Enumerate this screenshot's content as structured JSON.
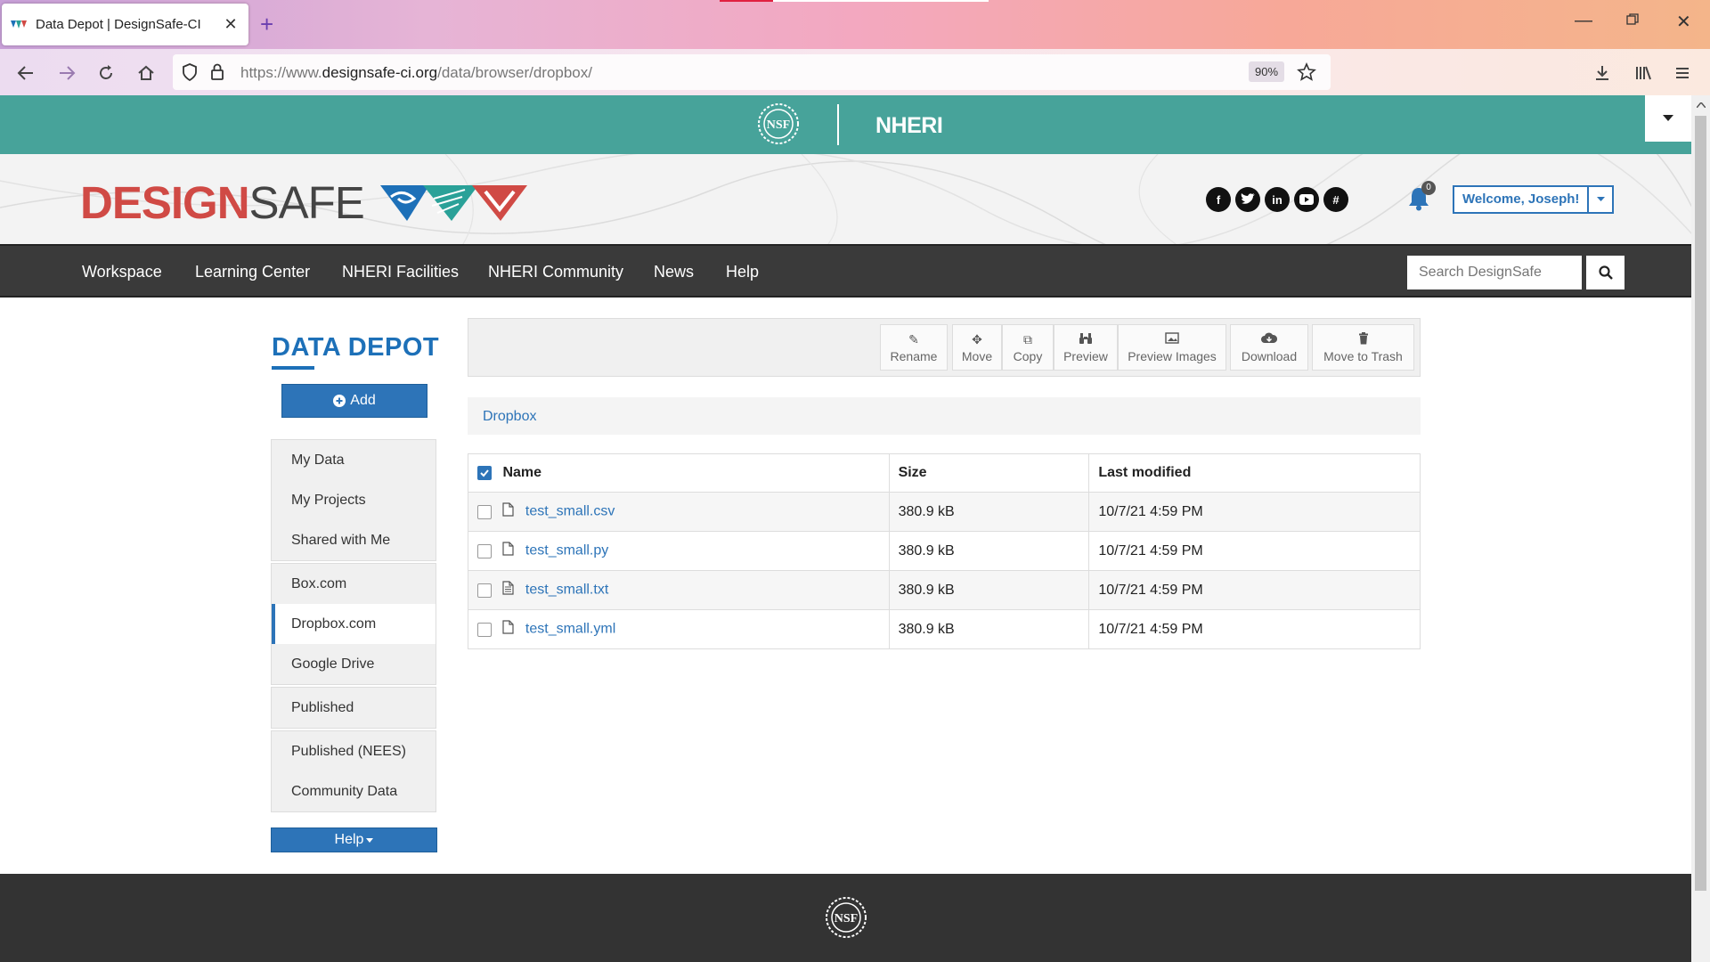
{
  "browser": {
    "tab_title": "Data Depot | DesignSafe-CI",
    "url_prefix": "https://www.",
    "url_domain": "designsafe-ci.org",
    "url_path": "/data/browser/dropbox/",
    "zoom": "90%"
  },
  "header": {
    "nsf_label": "NSF",
    "nheri_label": "NHERI",
    "logo_part1": "DESIGN",
    "logo_part2": "SAFE",
    "notification_count": "0",
    "welcome_label": "Welcome, Joseph!"
  },
  "mainnav": {
    "items": [
      "Workspace",
      "Learning Center",
      "NHERI Facilities",
      "NHERI Community",
      "News",
      "Help"
    ],
    "search_placeholder": "Search DesignSafe"
  },
  "sidebar": {
    "title": "DATA DEPOT",
    "add_label": "Add",
    "items": [
      "My Data",
      "My Projects",
      "Shared with Me",
      "Box.com",
      "Dropbox.com",
      "Google Drive",
      "Published",
      "Published (NEES)",
      "Community Data"
    ],
    "active_item": "Dropbox.com",
    "help_label": "Help"
  },
  "toolbar": {
    "buttons": [
      "Rename",
      "Move",
      "Copy",
      "Preview",
      "Preview Images",
      "Download",
      "Move to Trash"
    ]
  },
  "breadcrumb": "Dropbox",
  "table": {
    "headers": [
      "Name",
      "Size",
      "Last modified"
    ],
    "rows": [
      {
        "name": "test_small.csv",
        "size": "380.9 kB",
        "modified": "10/7/21 4:59 PM"
      },
      {
        "name": "test_small.py",
        "size": "380.9 kB",
        "modified": "10/7/21 4:59 PM"
      },
      {
        "name": "test_small.txt",
        "size": "380.9 kB",
        "modified": "10/7/21 4:59 PM"
      },
      {
        "name": "test_small.yml",
        "size": "380.9 kB",
        "modified": "10/7/21 4:59 PM"
      }
    ]
  },
  "colors": {
    "accent": "#2d74b8",
    "nheri_bar": "#47a39a",
    "logo_red": "#d04a45",
    "nav_dark": "#3a3a3a"
  }
}
